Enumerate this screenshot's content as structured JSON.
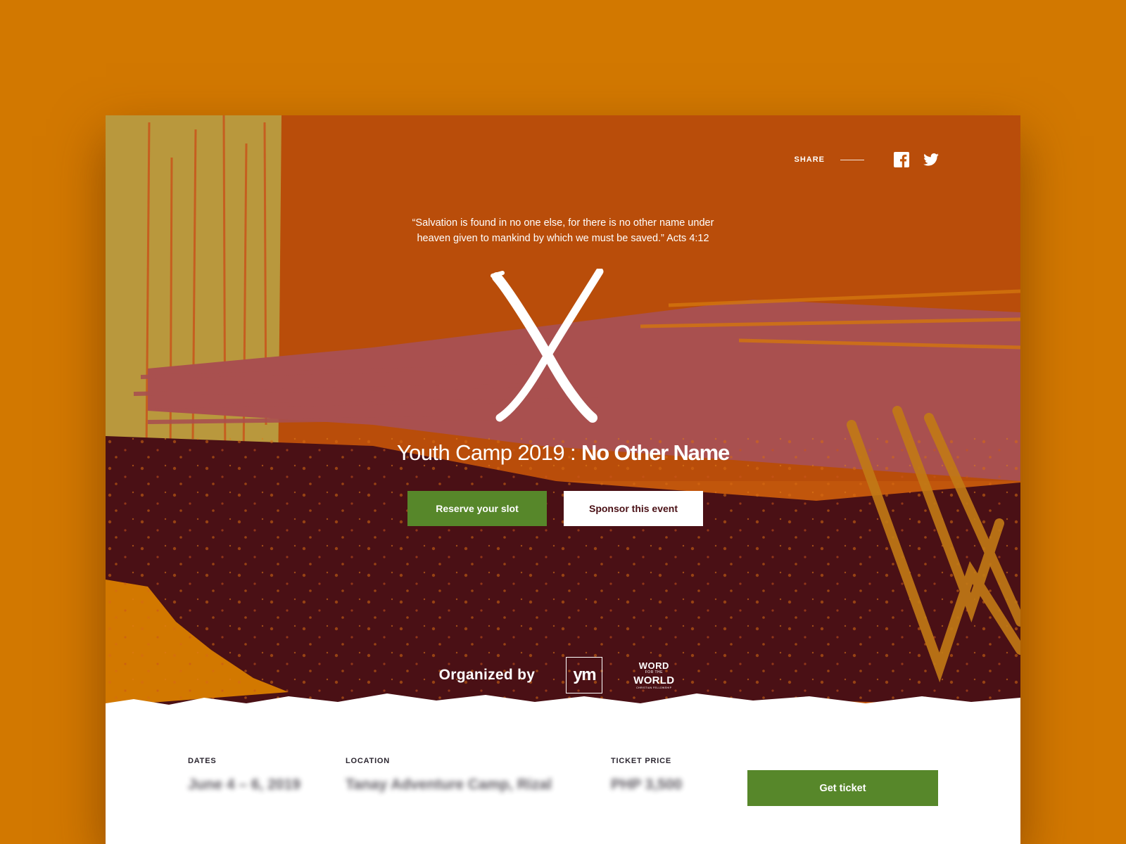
{
  "share": {
    "label": "SHARE",
    "icons": [
      "facebook-icon",
      "twitter-icon"
    ]
  },
  "hero": {
    "quote_line1": "“Salvation is found in no one else, for there is no other name under",
    "quote_line2": "heaven given to mankind by which we must be saved.” Acts 4:12",
    "title_light": "Youth Camp 2019 : ",
    "title_bold": "No Other Name",
    "reserve_button": "Reserve your slot",
    "sponsor_button": "Sponsor this event"
  },
  "organizers": {
    "label": "Organized by",
    "ym_logo_text": "ym",
    "wfw_logo": {
      "line1": "WORD",
      "line2": "FOR THE",
      "line3": "WORLD",
      "line4": "CHRISTIAN FELLOWSHIP"
    }
  },
  "details": {
    "dates_label": "DATES",
    "dates_value": "June 4 – 6, 2019",
    "location_label": "LOCATION",
    "location_value": "Tanay Adventure Camp, Rizal",
    "price_label": "TICKET PRICE",
    "price_value": "PHP 3,500",
    "ticket_button": "Get ticket"
  },
  "colors": {
    "page_background": "#d27800",
    "hero_orange": "#c1560c",
    "hero_maroon": "#4a1015",
    "hero_mauve": "#a9504f",
    "hero_ochre": "#b9983d",
    "primary_green": "#57872a",
    "text_dark": "#2b2630"
  }
}
